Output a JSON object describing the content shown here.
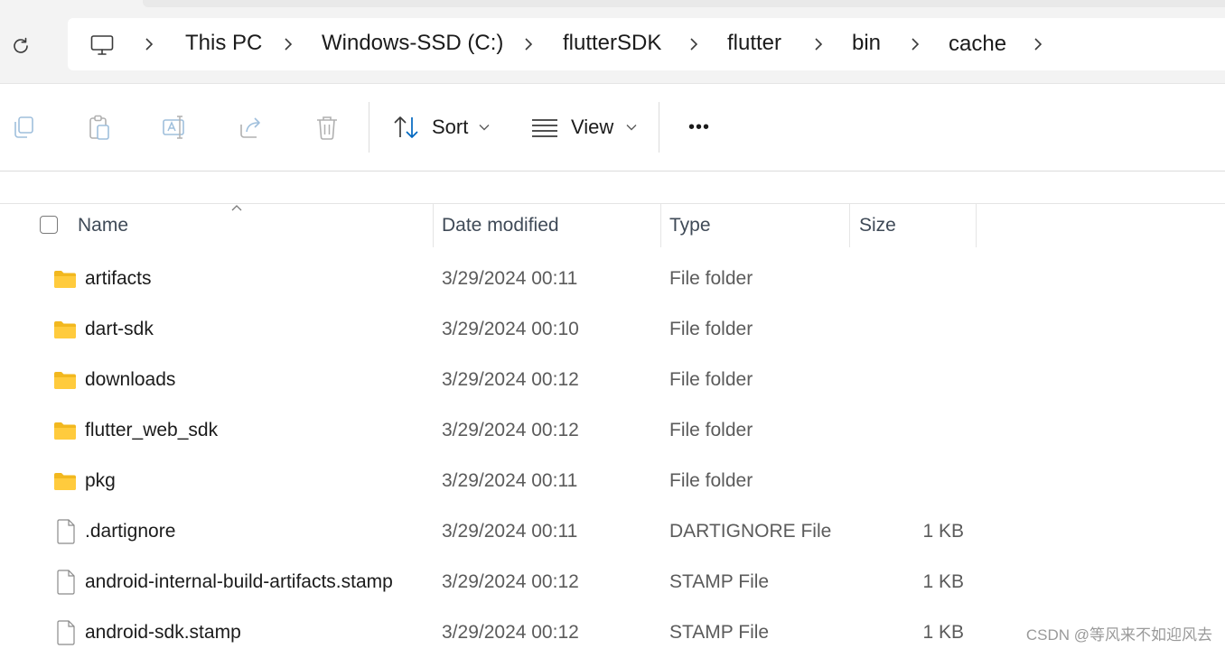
{
  "breadcrumb": {
    "items": [
      "This PC",
      "Windows-SSD (C:)",
      "flutterSDK",
      "flutter",
      "bin",
      "cache"
    ]
  },
  "toolbar": {
    "sort_label": "Sort",
    "view_label": "View",
    "more_label": "•••",
    "icons": [
      "copy-icon",
      "paste-icon",
      "rename-icon",
      "share-icon",
      "delete-icon"
    ]
  },
  "columns": {
    "name": "Name",
    "date": "Date modified",
    "type": "Type",
    "size": "Size"
  },
  "files": [
    {
      "name": "artifacts",
      "date": "3/29/2024 00:11",
      "type": "File folder",
      "size": "",
      "kind": "folder"
    },
    {
      "name": "dart-sdk",
      "date": "3/29/2024 00:10",
      "type": "File folder",
      "size": "",
      "kind": "folder"
    },
    {
      "name": "downloads",
      "date": "3/29/2024 00:12",
      "type": "File folder",
      "size": "",
      "kind": "folder"
    },
    {
      "name": "flutter_web_sdk",
      "date": "3/29/2024 00:12",
      "type": "File folder",
      "size": "",
      "kind": "folder"
    },
    {
      "name": "pkg",
      "date": "3/29/2024 00:11",
      "type": "File folder",
      "size": "",
      "kind": "folder"
    },
    {
      "name": ".dartignore",
      "date": "3/29/2024 00:11",
      "type": "DARTIGNORE File",
      "size": "1 KB",
      "kind": "file"
    },
    {
      "name": "android-internal-build-artifacts.stamp",
      "date": "3/29/2024 00:12",
      "type": "STAMP File",
      "size": "1 KB",
      "kind": "file"
    },
    {
      "name": "android-sdk.stamp",
      "date": "3/29/2024 00:12",
      "type": "STAMP File",
      "size": "1 KB",
      "kind": "file"
    }
  ],
  "watermark": "CSDN @等风来不如迎风去",
  "colors": {
    "folder": "#FFCB3D",
    "accent": "#0067C0",
    "text": "#1B1B1B",
    "muted": "#5B5B5B"
  }
}
